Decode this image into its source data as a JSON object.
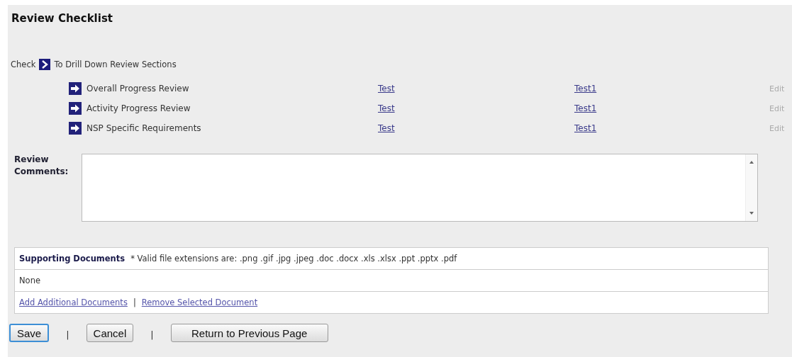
{
  "title": "Review Checklist",
  "instruction": {
    "before": "Check",
    "after": "To Drill Down Review Sections"
  },
  "sections": [
    {
      "name": "Overall Progress Review",
      "link_1": "Test",
      "link_2": "Test1",
      "edit": "Edit",
      "edit_disabled": true
    },
    {
      "name": "Activity Progress Review",
      "link_1": "Test",
      "link_2": "Test1",
      "edit": "Edit",
      "edit_disabled": true
    },
    {
      "name": "NSP Specific Requirements",
      "link_1": "Test",
      "link_2": "Test1",
      "edit": "Edit",
      "edit_disabled": true
    }
  ],
  "comments": {
    "label": "Review Comments:"
  },
  "supporting_documents": {
    "heading": "Supporting Documents",
    "note": "* Valid file extensions are: .png .gif .jpg .jpeg .doc .docx .xls .xlsx .ppt .pptx .pdf",
    "files": "None",
    "add_link": "Add Additional Documents",
    "separator": "|",
    "remove_link": "Remove Selected Document"
  },
  "buttons": [
    {
      "label": "Save",
      "focused": true
    },
    {
      "label": "Cancel",
      "focused": false
    },
    {
      "label": "Return to Previous Page",
      "focused": false
    }
  ],
  "button_separator": "|"
}
